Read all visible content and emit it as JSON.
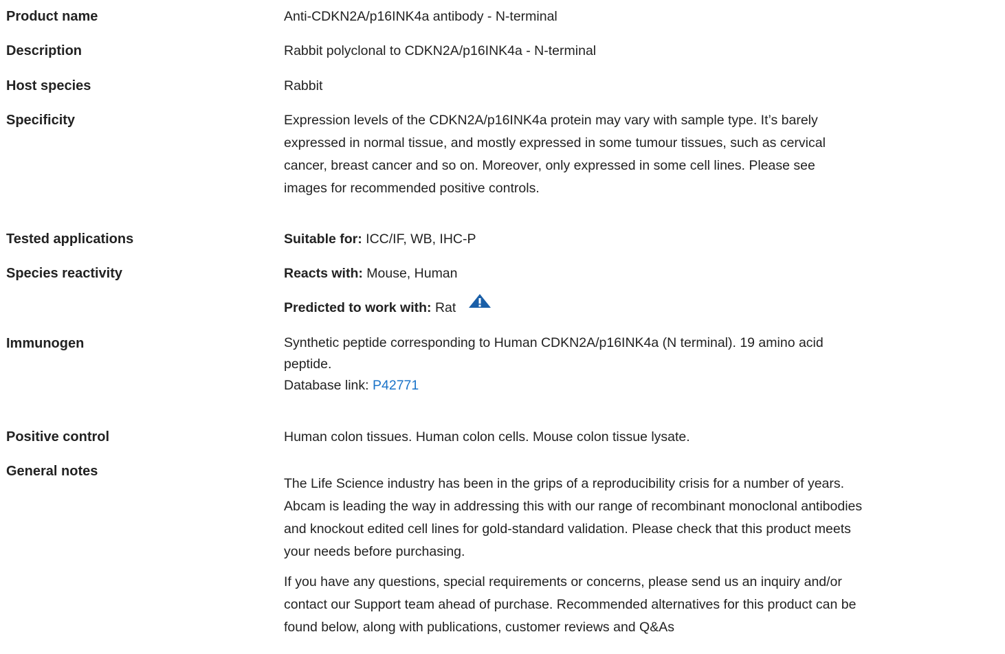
{
  "rows": {
    "product_name": {
      "label": "Product name",
      "value": "Anti-CDKN2A/p16INK4a antibody - N-terminal"
    },
    "description": {
      "label": "Description",
      "value": "Rabbit polyclonal to CDKN2A/p16INK4a - N-terminal"
    },
    "host_species": {
      "label": "Host species",
      "value": "Rabbit"
    },
    "specificity": {
      "label": "Specificity",
      "lines": [
        "Expression levels of the CDKN2A/p16INK4a protein may vary with sample type. It’s barely",
        "expressed in normal tissue, and mostly expressed in some tumour tissues, such as cervical",
        "cancer, breast cancer and so on. Moreover, only expressed in some cell lines. Please see",
        "images for recommended positive controls."
      ]
    },
    "tested_applications": {
      "label": "Tested applications",
      "prefix": "Suitable for:",
      "value": " ICC/IF, WB, IHC-P"
    },
    "species_reactivity": {
      "label": "Species reactivity",
      "reacts_prefix": "Reacts with:",
      "reacts_value": " Mouse, Human",
      "predicted_prefix": "Predicted to work with:",
      "predicted_value": " Rat",
      "warning_icon": "warning-triangle-icon",
      "warning_color": "#1a5fa8"
    },
    "immunogen": {
      "label": "Immunogen",
      "lines": [
        "Synthetic peptide corresponding to Human CDKN2A/p16INK4a (N terminal). 19 amino acid",
        "peptide."
      ],
      "db_prefix": "Database link: ",
      "db_link": "P42771"
    },
    "positive_control": {
      "label": "Positive control",
      "value": "Human colon tissues. Human colon cells. Mouse colon tissue lysate."
    },
    "general_notes": {
      "label": "General notes",
      "para1": [
        "The Life Science industry has been in the grips of a reproducibility crisis for a number of years.",
        "Abcam is leading the way in addressing this with our range of recombinant monoclonal antibodies",
        "and knockout edited cell lines for gold-standard validation. Please check that this product meets",
        "your needs before purchasing."
      ],
      "para2": [
        "If you have any questions, special requirements or concerns, please send us an inquiry and/or",
        "contact our Support team ahead of purchase. Recommended alternatives for this product can be",
        "found below, along with publications, customer reviews and Q&As"
      ]
    }
  },
  "colors": {
    "text": "#222222",
    "link": "#1a73c9"
  }
}
